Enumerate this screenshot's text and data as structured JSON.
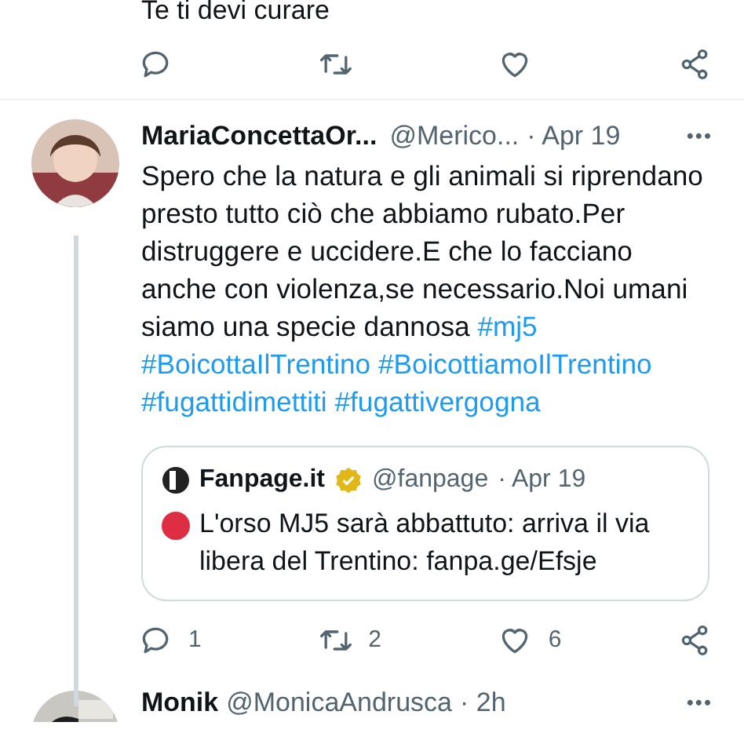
{
  "previous_tweet": {
    "text": "Te ti devi curare",
    "actions": [
      {
        "kind": "reply"
      },
      {
        "kind": "retweet"
      },
      {
        "kind": "like"
      },
      {
        "kind": "share"
      }
    ]
  },
  "tweet": {
    "name": "MariaConcettaOr...",
    "handle": "@Merico...",
    "time": "· Apr 19",
    "menu": "•••",
    "text": "Spero che la natura e gli animali si riprendano presto tutto ciò che abbiamo rubato.Per distruggere e uccidere.E che lo facciano anche con violenza,se necessario.Noi umani siamo una specie dannosa",
    "hashtags": [
      "#mj5",
      "#BoicottaIlTrentino",
      "#BoicottiamoIlTrentino",
      "#fugattidimettiti",
      "#fugattivergogna"
    ],
    "quote": {
      "name": "Fanpage.it",
      "verified": true,
      "handle": "@fanpage",
      "time": "· Apr 19",
      "text": "L'orso MJ5 sarà abbattuto: arriva il via libera del Trentino: fanpa.ge/Efsje"
    },
    "actions": [
      {
        "kind": "reply",
        "count": "1"
      },
      {
        "kind": "retweet",
        "count": "2"
      },
      {
        "kind": "like",
        "count": "6"
      },
      {
        "kind": "share"
      }
    ]
  },
  "next_tweet": {
    "name": "Monik",
    "handle": "@MonicaAndrusca",
    "time": "· 2h",
    "menu": "•••"
  }
}
